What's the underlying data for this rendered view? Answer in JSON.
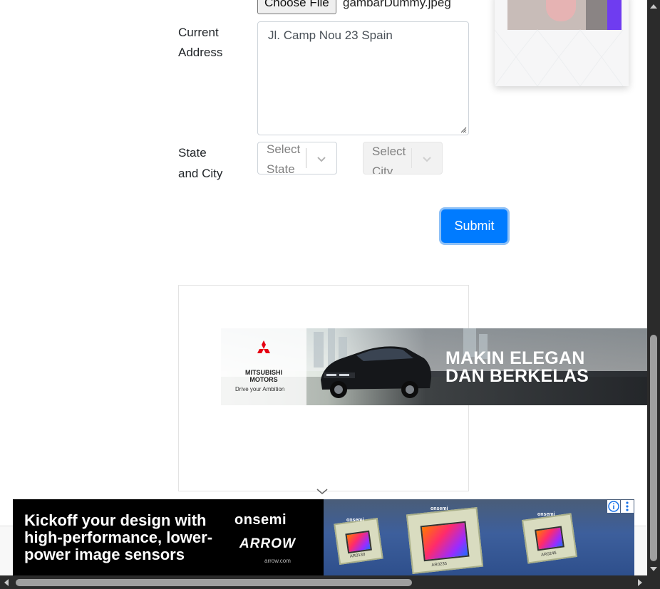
{
  "form": {
    "file_button": "Choose File",
    "file_name": "gambarDummy.jpeg",
    "address_label_1": "Current",
    "address_label_2": "Address",
    "address_value": "Jl. Camp Nou 23 Spain",
    "state_label_1": "State",
    "state_label_2": "and City",
    "state_placeholder_1": "Select",
    "state_placeholder_2": "State",
    "city_placeholder_1": "Select",
    "city_placeholder_2": "City",
    "submit_label": "Submit"
  },
  "banner_ad": {
    "brand": "MITSUBISHI MOTORS",
    "tagline": "Drive your Ambition",
    "headline_1": "MAKIN ELEGAN",
    "headline_2": "DAN BERKELAS"
  },
  "bottom_ad": {
    "copy": "Kickoff your design with high-performance, lower-power image sensors",
    "logo1": "onsemi",
    "logo2": "ARROW",
    "url": "arrow.com",
    "chips": [
      "AR0130",
      "AR0235",
      "AR0245"
    ]
  },
  "colors": {
    "submit": "#007bff",
    "accent_stripe": "#6f3cf0"
  }
}
